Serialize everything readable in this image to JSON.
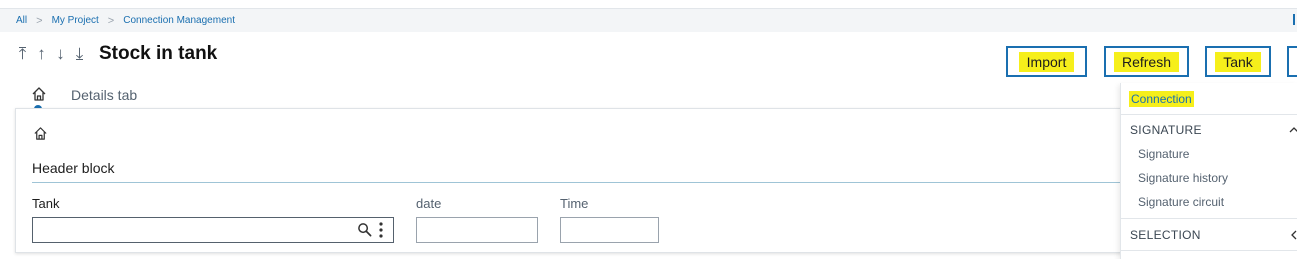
{
  "breadcrumb": {
    "items": [
      "All",
      "My Project",
      "Connection Management"
    ],
    "separator": ">"
  },
  "header": {
    "nav_arrows": [
      "⤒",
      "↑",
      "↓",
      "⤓"
    ],
    "title": "Stock in tank"
  },
  "actions": {
    "import_label": "Import",
    "refresh_label": "Refresh",
    "tank_label": "Tank"
  },
  "tabs": {
    "home_icon": "home-icon",
    "details_label": "Details tab"
  },
  "panel": {
    "home_icon": "home-icon",
    "block_title": "Header block",
    "fields": {
      "tank_label": "Tank",
      "tank_value": "",
      "date_label": "date",
      "date_value": "",
      "time_label": "Time",
      "time_value": ""
    }
  },
  "side_menu": {
    "connection_label": "Connection",
    "signature": {
      "heading": "SIGNATURE",
      "items": [
        "Signature",
        "Signature history",
        "Signature circuit"
      ]
    },
    "selection": {
      "heading": "SELECTION"
    }
  },
  "colors": {
    "accent": "#1a6fb0",
    "highlight": "#f6ef1b",
    "breadcrumb_bg": "#f3f5f7"
  }
}
